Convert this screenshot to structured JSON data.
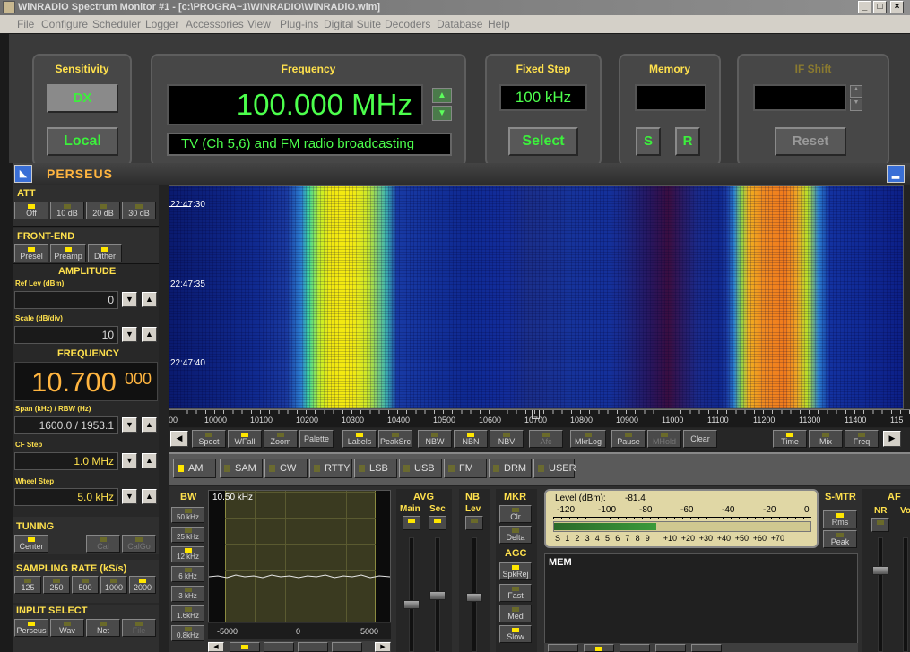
{
  "title": "WiNRADiO Spectrum Monitor #1 - [c:\\PROGRA~1\\WINRADIO\\WiNRADiO.wim]",
  "menu": [
    "File",
    "Configure",
    "Scheduler",
    "Logger",
    "Accessories",
    "View",
    "Plug-ins",
    "Digital Suite",
    "Decoders",
    "Database",
    "Help"
  ],
  "window_buttons": [
    "_",
    "□",
    "×"
  ],
  "sensitivity": {
    "label": "Sensitivity",
    "dx": "DX",
    "local": "Local"
  },
  "frequency": {
    "label": "Frequency",
    "value": "100.000 MHz",
    "service": "TV (Ch 5,6) and FM radio broadcasting"
  },
  "fixed_step": {
    "label": "Fixed Step",
    "value": "100 kHz",
    "select": "Select"
  },
  "memory": {
    "label": "Memory",
    "s": "S",
    "r": "R"
  },
  "if_shift": {
    "label": "IF Shift",
    "reset": "Reset"
  },
  "perseus": {
    "title": "PERSEUS"
  },
  "left": {
    "att": "ATT",
    "att_buttons": [
      "Off",
      "10 dB",
      "20 dB",
      "30 dB"
    ],
    "frontend": "FRONT-END",
    "frontend_buttons": [
      "Presel",
      "Preamp",
      "Dither"
    ],
    "amplitude": "AMPLITUDE",
    "ref_lev_label": "Ref Lev (dBm)",
    "ref_lev": "0",
    "scale_label": "Scale (dB/div)",
    "scale": "10",
    "frequency_label": "FREQUENCY",
    "freq_main": "10.700",
    "freq_small": "000",
    "span_label": "Span (kHz) / RBW (Hz)",
    "span": "1600.0 / 1953.1",
    "cf_step_label": "CF Step",
    "cf_step": "1.0 MHz",
    "wheel_label": "Wheel Step",
    "wheel": "5.0 kHz",
    "tuning": "TUNING",
    "tuning_buttons": [
      "Center",
      "Cal",
      "CalGo"
    ],
    "sampling": "SAMPLING RATE (kS/s)",
    "sampling_buttons": [
      "125",
      "250",
      "500",
      "1000",
      "2000"
    ],
    "input": "INPUT SELECT",
    "input_buttons": [
      "Perseus",
      "Wav",
      "Net",
      "File"
    ]
  },
  "waterfall": {
    "timestamps": [
      "22:47:30",
      "22:47:35",
      "22:47:40"
    ],
    "axis_ticks": [
      "10000",
      "10100",
      "10200",
      "10300",
      "10400",
      "10500",
      "10600",
      "10700",
      "10800",
      "10900",
      "11000",
      "11100",
      "11200",
      "11300",
      "11400",
      "115"
    ],
    "axis_first": "00"
  },
  "toolbar": {
    "left": [
      "Spect",
      "WFall",
      "Zoom",
      "Palette",
      "Labels",
      "PeakSrc",
      "NBW",
      "NBN",
      "NBV",
      "Afc",
      "MkrLog",
      "Pause",
      "MHold",
      "Clear"
    ],
    "right": [
      "Time",
      "Mix",
      "Freq"
    ]
  },
  "modes": [
    "AM",
    "SAM",
    "CW",
    "RTTY",
    "LSB",
    "USB",
    "FM",
    "DRM",
    "USER"
  ],
  "bw": {
    "label": "BW",
    "buttons": [
      "50 kHz",
      "25 kHz",
      "12 kHz",
      "6 kHz",
      "3 kHz",
      "1.6kHz",
      "0.8kHz"
    ],
    "display": "10.50 kHz",
    "axis": [
      "-5000",
      "0",
      "5000"
    ]
  },
  "avg": {
    "label": "AVG",
    "main": "Main",
    "sec": "Sec"
  },
  "nb": {
    "label": "NB",
    "lev": "Lev"
  },
  "mkr": {
    "label": "MKR",
    "buttons": [
      "Clr",
      "Delta"
    ]
  },
  "agc": {
    "label": "AGC",
    "buttons": [
      "SpkRej",
      "Fast",
      "Med",
      "Slow"
    ]
  },
  "meter": {
    "level_label": "Level (dBm):",
    "level_value": "-81.4",
    "dbm_ticks": [
      "-120",
      "-100",
      "-80",
      "-60",
      "-40",
      "-20",
      "0"
    ],
    "s_ticks": [
      "S",
      "1",
      "2",
      "3",
      "4",
      "5",
      "6",
      "7",
      "8",
      "9",
      "+10",
      "+20",
      "+30",
      "+40",
      "+50",
      "+60",
      "+70"
    ],
    "level_fraction": 0.4
  },
  "smtr": {
    "label": "S-MTR",
    "buttons": [
      "Rms",
      "Peak"
    ]
  },
  "mem": {
    "label": "MEM"
  },
  "af": {
    "label": "AF",
    "nr": "NR",
    "vol": "Vo"
  }
}
